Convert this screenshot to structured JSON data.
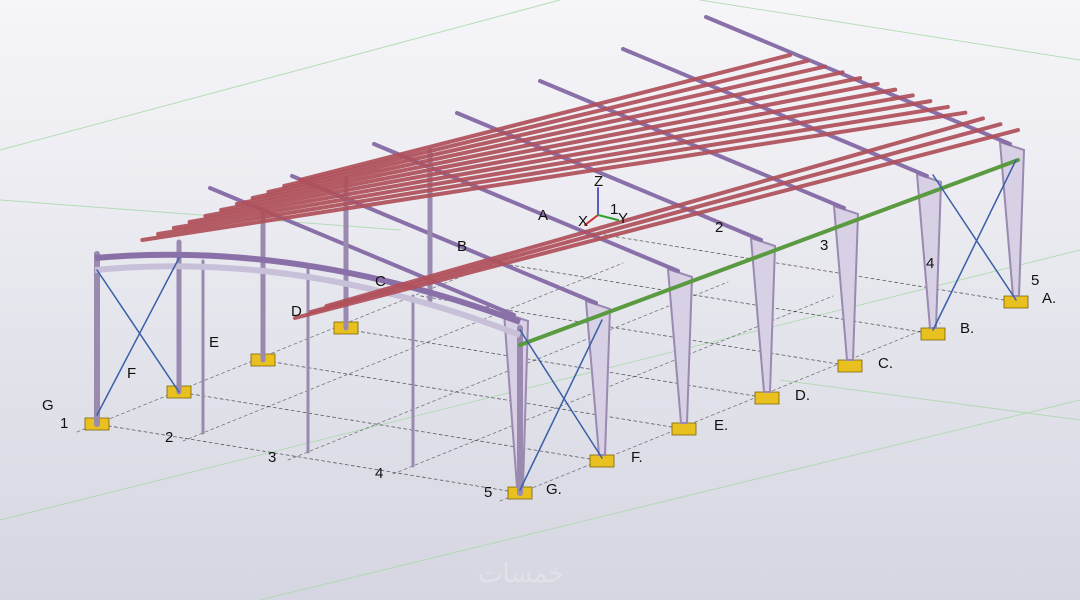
{
  "grid": {
    "front_numbers": [
      "1",
      "2",
      "3",
      "4",
      "5"
    ],
    "right_letters": [
      "A.",
      "B.",
      "C.",
      "D.",
      "E.",
      "F.",
      "G."
    ],
    "left_letters": [
      "G",
      "F",
      "E",
      "D",
      "C",
      "B",
      "A"
    ],
    "back_numbers": [
      "2",
      "3",
      "4",
      "5"
    ]
  },
  "axes": {
    "z": "Z",
    "x": "X",
    "y": "Y",
    "origin": "1"
  },
  "colors": {
    "background_top": "#f4f4f8",
    "background_bottom": "#d8d8e4",
    "purlin": "#b0505a",
    "rafter": "#8a70a8",
    "column": "#9a8ab0",
    "bracing": "#3a5fa8",
    "base_plate": "#e8c020",
    "edge_strut": "#5a9a40",
    "gridline": "#222222"
  },
  "watermark": "خمسات"
}
